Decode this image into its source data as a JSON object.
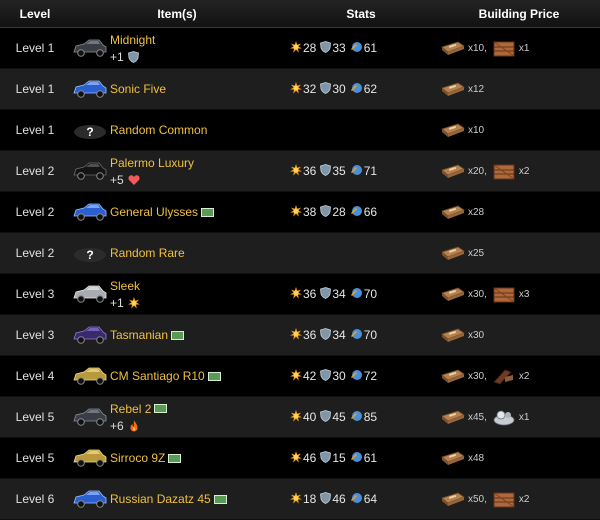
{
  "headers": {
    "level": "Level",
    "items": "Item(s)",
    "stats": "Stats",
    "price": "Building Price"
  },
  "rows": [
    {
      "level": "Level 1",
      "name": "Midnight",
      "bonus": "+1",
      "bonus_icon": "shield-icon",
      "cash": false,
      "thumb": "dark-car-icon",
      "stats": [
        "28",
        "33",
        "61"
      ],
      "price": [
        {
          "qty": "x10,",
          "icon": "part-crate-icon"
        },
        {
          "qty": "x1",
          "icon": "wooden-crate-icon"
        }
      ]
    },
    {
      "level": "Level 1",
      "name": "Sonic Five",
      "bonus": "",
      "bonus_icon": "",
      "cash": false,
      "thumb": "blue-car-icon",
      "stats": [
        "32",
        "30",
        "62"
      ],
      "price": [
        {
          "qty": "x12",
          "icon": "part-crate-icon"
        }
      ]
    },
    {
      "level": "Level 1",
      "name": "Random Common",
      "bonus": "",
      "bonus_icon": "",
      "cash": false,
      "thumb": "mystery-car-icon",
      "stats": [],
      "price": [
        {
          "qty": "x10",
          "icon": "part-crate-icon"
        }
      ]
    },
    {
      "level": "Level 2",
      "name": "Palermo Luxury",
      "bonus": "+5",
      "bonus_icon": "heart-icon",
      "cash": false,
      "thumb": "black-car-icon",
      "stats": [
        "36",
        "35",
        "71"
      ],
      "price": [
        {
          "qty": "x20,",
          "icon": "part-crate-icon"
        },
        {
          "qty": "x2",
          "icon": "wooden-crate-icon"
        }
      ]
    },
    {
      "level": "Level 2",
      "name": "General Ulysses",
      "bonus": "",
      "bonus_icon": "",
      "cash": true,
      "thumb": "blue-car-icon",
      "stats": [
        "38",
        "28",
        "66"
      ],
      "price": [
        {
          "qty": "x28",
          "icon": "part-crate-icon"
        }
      ]
    },
    {
      "level": "Level 2",
      "name": "Random Rare",
      "bonus": "",
      "bonus_icon": "",
      "cash": false,
      "thumb": "mystery-car-icon",
      "stats": [],
      "price": [
        {
          "qty": "x25",
          "icon": "part-crate-icon"
        }
      ]
    },
    {
      "level": "Level 3",
      "name": "Sleek",
      "bonus": "+1",
      "bonus_icon": "attack-icon",
      "cash": false,
      "thumb": "silver-car-icon",
      "stats": [
        "36",
        "34",
        "70"
      ],
      "price": [
        {
          "qty": "x30,",
          "icon": "part-crate-icon"
        },
        {
          "qty": "x3",
          "icon": "wooden-crate-icon"
        }
      ]
    },
    {
      "level": "Level 3",
      "name": "Tasmanian",
      "bonus": "",
      "bonus_icon": "",
      "cash": true,
      "thumb": "purple-car-icon",
      "stats": [
        "36",
        "34",
        "70"
      ],
      "price": [
        {
          "qty": "x30",
          "icon": "part-crate-icon"
        }
      ]
    },
    {
      "level": "Level 4",
      "name": "CM Santiago R10",
      "bonus": "",
      "bonus_icon": "",
      "cash": true,
      "thumb": "gold-car-icon",
      "stats": [
        "42",
        "30",
        "72"
      ],
      "price": [
        {
          "qty": "x30,",
          "icon": "part-crate-icon"
        },
        {
          "qty": "x2",
          "icon": "brown-part-icon"
        }
      ]
    },
    {
      "level": "Level 5",
      "name": "Rebel 2",
      "bonus": "+6",
      "bonus_icon": "fire-icon",
      "cash": true,
      "thumb": "dark-car-icon",
      "stats": [
        "40",
        "45",
        "85"
      ],
      "price": [
        {
          "qty": "x45,",
          "icon": "part-crate-icon"
        },
        {
          "qty": "x1",
          "icon": "metal-part-icon"
        }
      ]
    },
    {
      "level": "Level 5",
      "name": "Sirroco 9Z",
      "bonus": "",
      "bonus_icon": "",
      "cash": true,
      "thumb": "gold-car-icon",
      "stats": [
        "46",
        "15",
        "61"
      ],
      "price": [
        {
          "qty": "x48",
          "icon": "part-crate-icon"
        }
      ]
    },
    {
      "level": "Level 6",
      "name": "Russian Dazatz 45",
      "bonus": "",
      "bonus_icon": "",
      "cash": true,
      "thumb": "blue-car-icon",
      "stats": [
        "18",
        "46",
        "64"
      ],
      "price": [
        {
          "qty": "x50,",
          "icon": "part-crate-icon"
        },
        {
          "qty": "x2",
          "icon": "brown-crate-icon"
        }
      ]
    }
  ],
  "colors": {
    "item_name": "#f0c040",
    "attack": "#f7a21b",
    "defense": "#7f95a8",
    "total": "#4a90d9",
    "row_alt": "#1e1e1e"
  }
}
